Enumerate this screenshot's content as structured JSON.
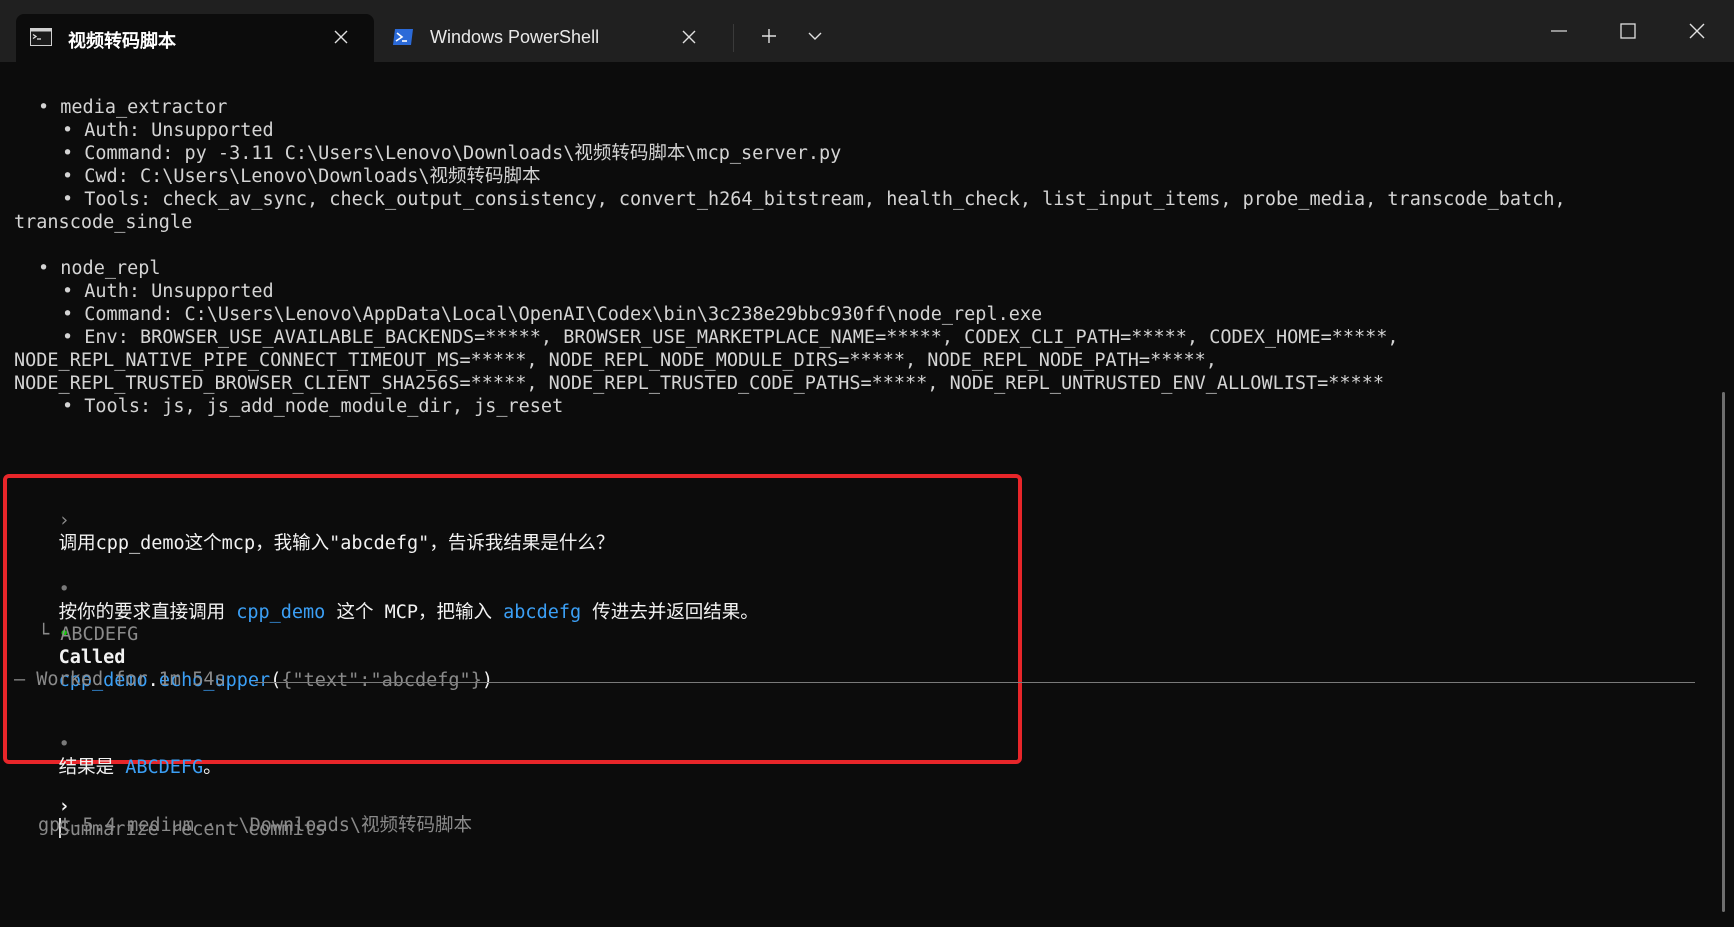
{
  "window": {
    "tabs": [
      {
        "title": "视频转码脚本",
        "icon": "cmd-terminal-icon",
        "active": true
      },
      {
        "title": "Windows PowerShell",
        "icon": "powershell-icon",
        "active": false
      }
    ],
    "new_tab_glyph": "+",
    "dropdown_glyph": "⌄"
  },
  "terminal": {
    "mcp_media": {
      "name": "• media_extractor",
      "auth": "• Auth: Unsupported",
      "command": "• Command: py -3.11 C:\\Users\\Lenovo\\Downloads\\视频转码脚本\\mcp_server.py",
      "cwd": "• Cwd: C:\\Users\\Lenovo\\Downloads\\视频转码脚本",
      "tools_1": "• Tools: check_av_sync, check_output_consistency, convert_h264_bitstream, health_check, list_input_items, probe_media, transcode_batch,",
      "tools_2": "transcode_single"
    },
    "mcp_node": {
      "name": "• node_repl",
      "auth": "• Auth: Unsupported",
      "command": "• Command: C:\\Users\\Lenovo\\AppData\\Local\\OpenAI\\Codex\\bin\\3c238e29bbc930ff\\node_repl.exe",
      "env_1": "• Env: BROWSER_USE_AVAILABLE_BACKENDS=*****, BROWSER_USE_MARKETPLACE_NAME=*****, CODEX_CLI_PATH=*****, CODEX_HOME=*****,",
      "env_2": "NODE_REPL_NATIVE_PIPE_CONNECT_TIMEOUT_MS=*****, NODE_REPL_NODE_MODULE_DIRS=*****, NODE_REPL_NODE_PATH=*****,",
      "env_3": "NODE_REPL_TRUSTED_BROWSER_CLIENT_SHA256S=*****, NODE_REPL_TRUSTED_CODE_PATHS=*****, NODE_REPL_UNTRUSTED_ENV_ALLOWLIST=*****",
      "tools": "• Tools: js, js_add_node_module_dir, js_reset"
    },
    "conversation": {
      "user_prompt_marker": "›",
      "user_prompt": "调用cpp_demo这个mcp，我输入\"abcdefg\"，告诉我结果是什么？",
      "reply_bullet": "•",
      "reply_prefix": "按你的要求直接调用 ",
      "reply_tool": "cpp_demo",
      "reply_mid": " 这个 MCP，把输入 ",
      "reply_input": "abcdefg",
      "reply_suffix": " 传进去并返回结果。",
      "call_bullet": "•",
      "call_word": "Called",
      "call_server": "cpp_demo",
      "call_dot": ".",
      "call_fn": "echo_upper",
      "call_open": "(",
      "call_args": "{\"text\":\"abcdefg\"}",
      "call_close": ")",
      "call_result": "└ ABCDEFG",
      "worked": "— Worked for 1m 54s",
      "result_bullet": "•",
      "result_prefix": "结果是 ",
      "result_value": "ABCDEFG",
      "result_suffix": "。"
    },
    "input": {
      "prompt_marker": "›",
      "placeholder": "Summarize recent commits"
    },
    "status_line": "gpt-5.4 medium · ~\\Downloads\\视频转码脚本"
  },
  "colors": {
    "background": "#0c0c0c",
    "titlebar": "#202020",
    "accent_blue": "#3b9ff5",
    "success_green": "#16c60c",
    "highlight_red": "#e8262a"
  }
}
